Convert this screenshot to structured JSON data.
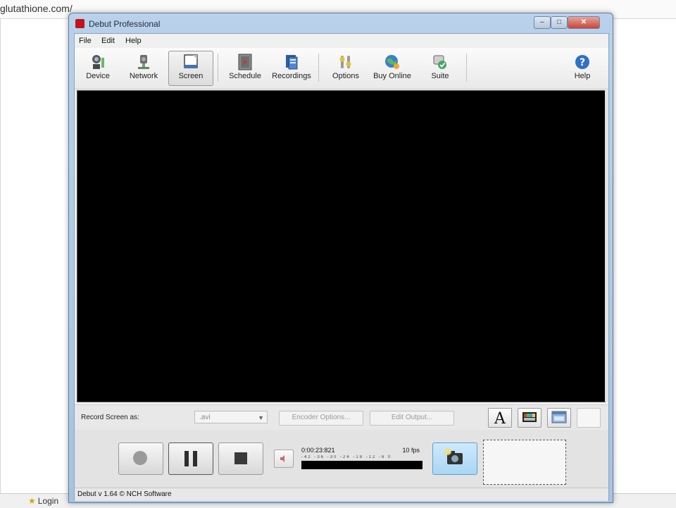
{
  "browser": {
    "url_fragment": "glutathione.com/",
    "favorite_label": "Login"
  },
  "window": {
    "title": "Debut Professional",
    "controls": {
      "minimize": "–",
      "maximize": "□",
      "close": "✕"
    }
  },
  "menu": [
    "File",
    "Edit",
    "Help"
  ],
  "toolbar": {
    "device": "Device",
    "network": "Network",
    "screen": "Screen",
    "schedule": "Schedule",
    "recordings": "Recordings",
    "options": "Options",
    "buy_online": "Buy Online",
    "suite": "Suite",
    "help": "Help",
    "active": "Screen"
  },
  "options_bar": {
    "record_label": "Record Screen as:",
    "format_value": ".avi",
    "encoder_options": "Encoder Options...",
    "edit_output": "Edit Output..."
  },
  "transport": {
    "timer": "0:00:23:821",
    "fps": "10 fps",
    "meter_scale": "-42 -36 -30 -24 -18 -12 -6 0"
  },
  "statusbar": {
    "text": "Debut v 1.64 © NCH Software"
  },
  "colors": {
    "titlebar": "#b9d1ea",
    "preview_bg": "#000000",
    "close_button": "#c9463a",
    "snapshot_button": "#a9d6f5"
  }
}
